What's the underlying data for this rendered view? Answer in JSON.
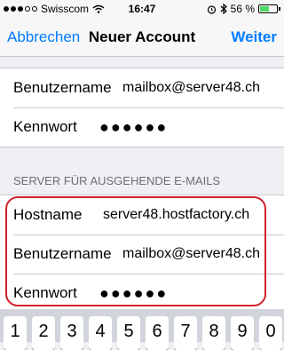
{
  "status_bar": {
    "carrier": "Swisscom",
    "time": "16:47",
    "battery_percent_label": "56 %",
    "battery_level": 0.56,
    "signal_dots_full": 3,
    "signal_dots_total": 5,
    "icons": [
      "wifi-icon",
      "alarm-icon",
      "bluetooth-icon",
      "battery-icon"
    ]
  },
  "nav": {
    "cancel_label": "Abbrechen",
    "title": "Neuer Account",
    "next_label": "Weiter",
    "accent_color": "#007aff"
  },
  "incoming": {
    "rows": [
      {
        "label": "Benutzername",
        "value": "mailbox@server48.ch"
      },
      {
        "label": "Kennwort",
        "value": "●●●●●●"
      }
    ]
  },
  "outgoing": {
    "header": "SERVER FÜR AUSGEHENDE E-MAILS",
    "rows": [
      {
        "label": "Hostname",
        "value": "server48.hostfactory.ch"
      },
      {
        "label": "Benutzername",
        "value": "mailbox@server48.ch"
      },
      {
        "label": "Kennwort",
        "value": "●●●●●●"
      }
    ],
    "highlight_color": "#d0202a"
  },
  "keyboard": {
    "keys": [
      "1",
      "2",
      "3",
      "4",
      "5",
      "6",
      "7",
      "8",
      "9",
      "0"
    ]
  }
}
